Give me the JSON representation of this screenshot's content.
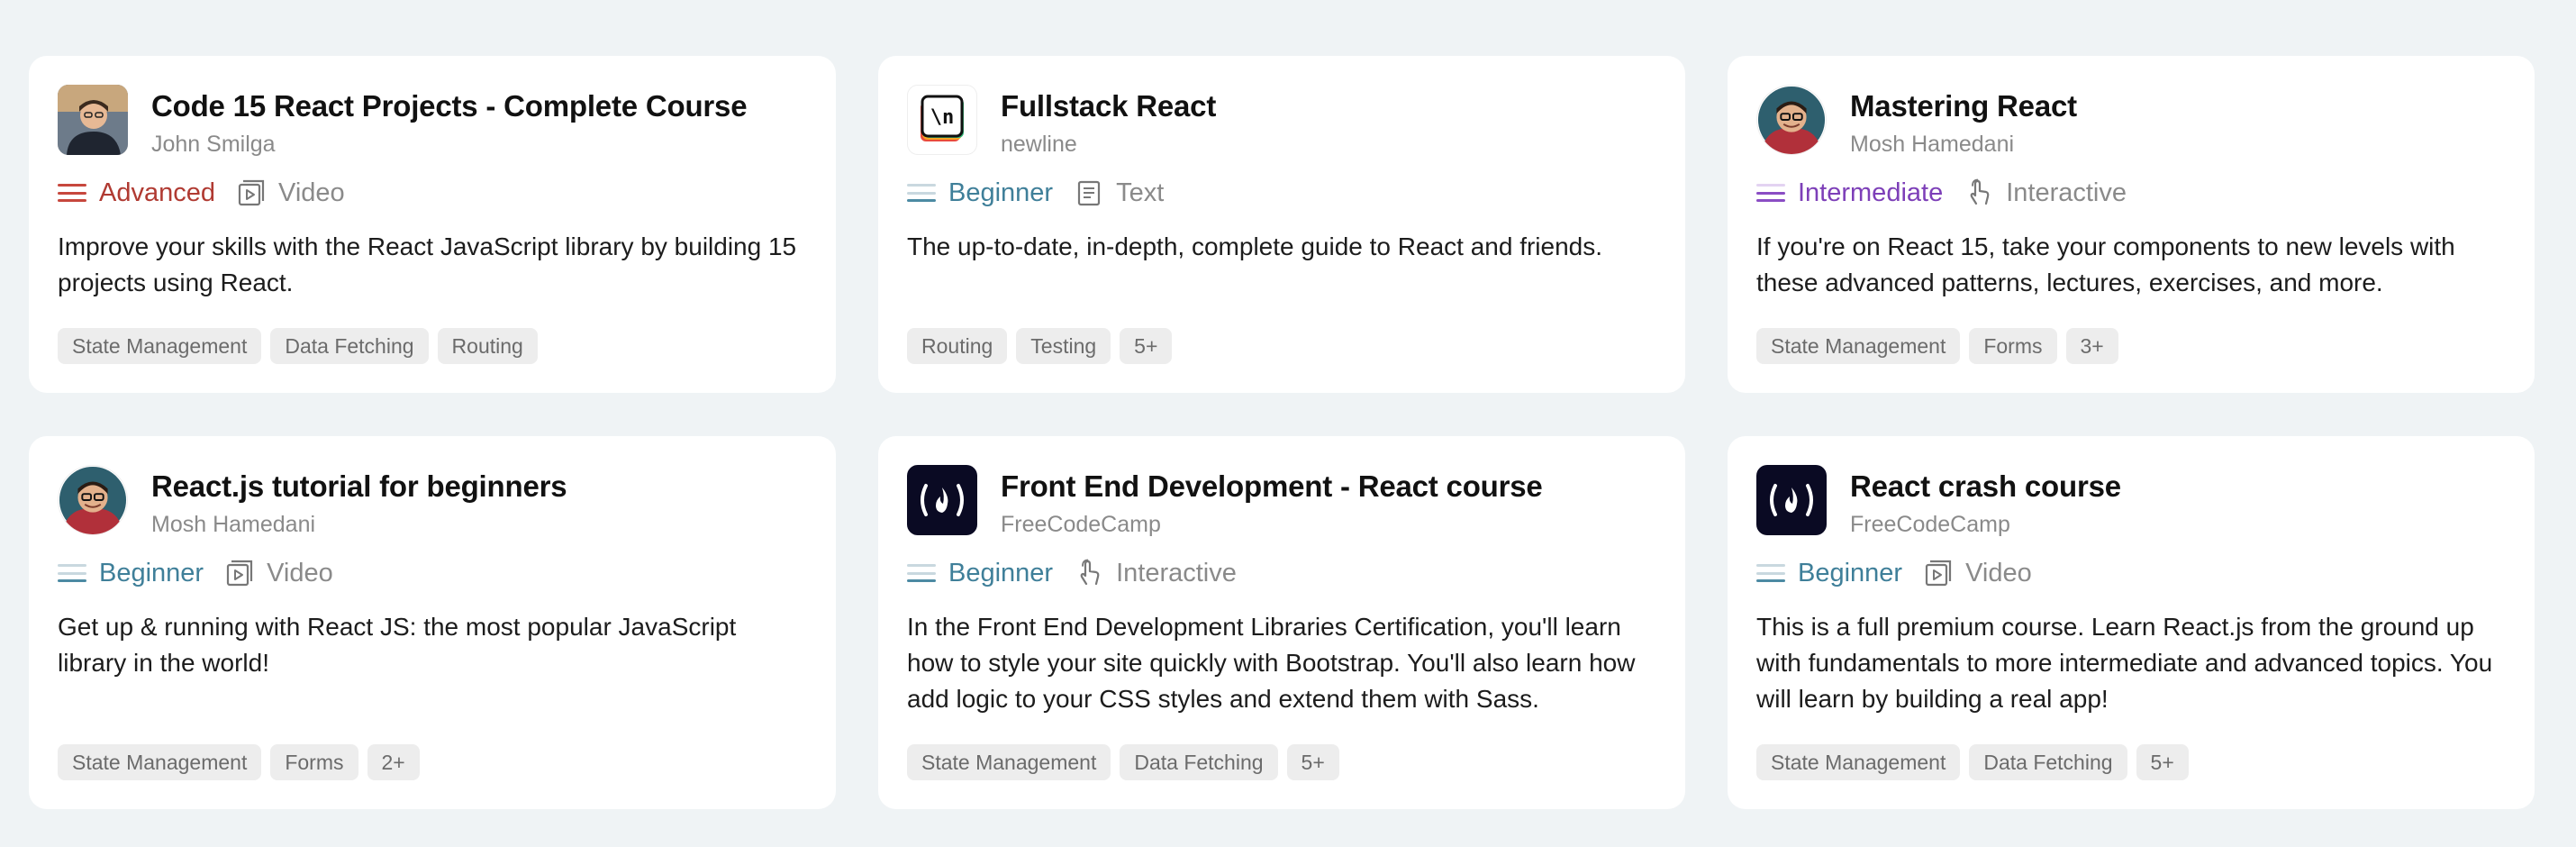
{
  "courses": [
    {
      "title": "Code 15 React Projects - Complete Course",
      "author": "John Smilga",
      "level": "Advanced",
      "level_color": "#c0392b",
      "format": "Video",
      "format_icon": "video-icon",
      "description": "Improve your skills with the React JavaScript library by building 15 projects using React.",
      "tags": [
        "State Management",
        "Data Fetching",
        "Routing"
      ]
    },
    {
      "title": "Fullstack React",
      "author": "newline",
      "level": "Beginner",
      "level_color": "#3f7f99",
      "format": "Text",
      "format_icon": "document-icon",
      "description": "The up-to-date, in-depth, complete guide to React and friends.",
      "tags": [
        "Routing",
        "Testing",
        "5+"
      ]
    },
    {
      "title": "Mastering React",
      "author": "Mosh Hamedani",
      "level": "Intermediate",
      "level_color": "#7d3fb8",
      "format": "Interactive",
      "format_icon": "pointer-hand-icon",
      "description": "If you're on React 15, take your components to new levels with these advanced patterns, lectures, exercises, and more.",
      "tags": [
        "State Management",
        "Forms",
        "3+"
      ]
    },
    {
      "title": "React.js tutorial for beginners",
      "author": "Mosh Hamedani",
      "level": "Beginner",
      "level_color": "#3f7f99",
      "format": "Video",
      "format_icon": "video-icon",
      "description": "Get up & running with React JS: the most popular JavaScript library in the world!",
      "tags": [
        "State Management",
        "Forms",
        "2+"
      ]
    },
    {
      "title": "Front End Development - React course",
      "author": "FreeCodeCamp",
      "level": "Beginner",
      "level_color": "#3f7f99",
      "format": "Interactive",
      "format_icon": "pointer-hand-icon",
      "description": "In the Front End Development Libraries Certification, you'll learn how to style your site quickly with Bootstrap. You'll also learn how add logic to your CSS styles and extend them with Sass.",
      "tags": [
        "State Management",
        "Data Fetching",
        "5+"
      ]
    },
    {
      "title": "React crash course",
      "author": "FreeCodeCamp",
      "level": "Beginner",
      "level_color": "#3f7f99",
      "format": "Video",
      "format_icon": "video-icon",
      "description": "This is a full premium course. Learn React.js from the ground up with fundamentals to more intermediate and advanced topics. You will learn by building a real app!",
      "tags": [
        "State Management",
        "Data Fetching",
        "5+"
      ]
    }
  ]
}
